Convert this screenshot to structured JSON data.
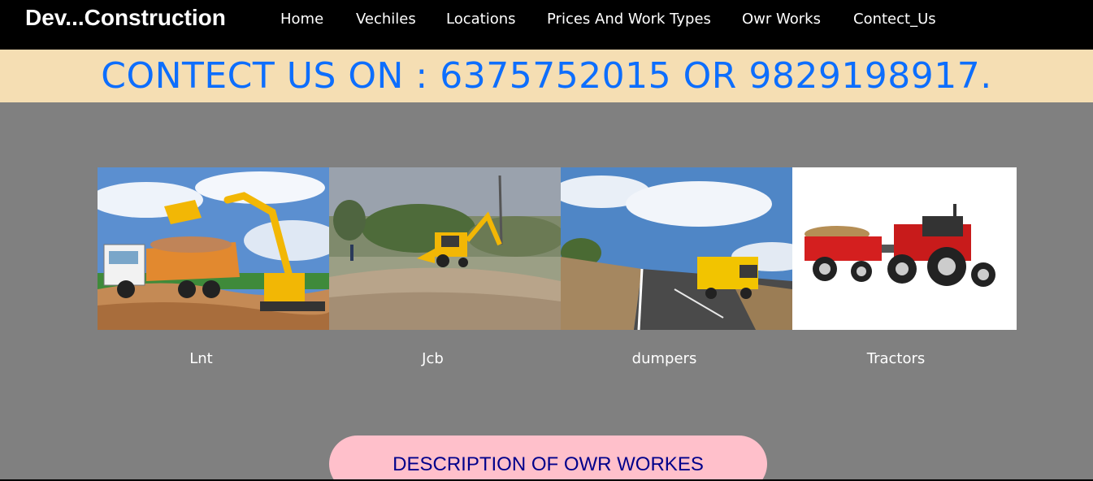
{
  "navbar": {
    "brand": "Dev...Construction",
    "items": [
      "Home",
      "Vechiles",
      "Locations",
      "Prices And Work Types",
      "Owr Works",
      "Contect_Us"
    ]
  },
  "banner": {
    "text": "CONTECT US ON : 6375752015 OR 9829198917."
  },
  "gallery": {
    "captions": [
      "Lnt",
      "Jcb",
      "dumpers",
      "Tractors"
    ]
  },
  "description_button": {
    "label": "DESCRIPTION OF OWR WORKES"
  },
  "colors": {
    "navbar_bg": "#000000",
    "banner_bg": "#f5deb3",
    "banner_text": "#0d6efd",
    "page_bg": "#808080",
    "button_bg": "#ffc0cb",
    "button_text": "#00008b"
  }
}
